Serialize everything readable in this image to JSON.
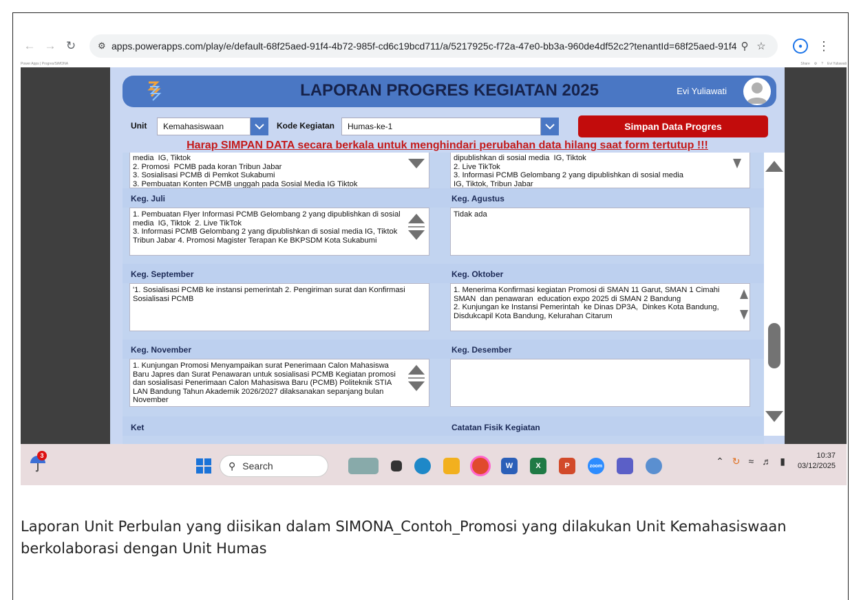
{
  "browser": {
    "url": "apps.powerapps.com/play/e/default-68f25aed-91f4-4b72-985f-cd6c19bcd711/a/5217925c-f72a-47e0-bb3a-960de4df52c2?tenantId=68f25aed-91f4-4b72...",
    "bookmark_left": "Power Apps | Progres/SiMONA",
    "bookmarks_right": [
      "Share",
      "⚙",
      "?",
      "Evi Yuliawati"
    ]
  },
  "app": {
    "title": "LAPORAN PROGRES KEGIATAN 2025",
    "user_name": "Evi Yuliawati",
    "unit_label": "Unit",
    "unit_value": "Kemahasiswaan",
    "kode_label": "Kode Kegiatan",
    "kode_value": "Humas-ke-1",
    "save_label": "Simpan Data Progres",
    "warning": "Harap SIMPAN DATA secara berkala untuk menghindari perubahan data hilang saat form tertutup !!!",
    "top_left_text": "media  IG, Tiktok\n2. Promosi  PCMB pada koran Tribun Jabar\n3. Sosialisasi PCMB di Pemkot Sukabumi\n3. Pembuatan Konten PCMB unggah pada Sosial Media IG Tiktok",
    "top_right_text": "dipublishkan di sosial media  IG, Tiktok\n2. Live TikTok\n3. Informasi PCMB Gelombang 2 yang dipublishkan di sosial media\nIG, Tiktok, Tribun Jabar",
    "sections": {
      "juli_label": "Keg. Juli",
      "juli_text": "1. Pembuatan Flyer Informasi PCMB Gelombang 2 yang dipublishkan di sosial media  IG, Tiktok  2. Live TikTok\n3. Informasi PCMB Gelombang 2 yang dipublishkan di sosial media IG, Tiktok  Tribun Jabar 4. Promosi Magister Terapan Ke BKPSDM Kota Sukabumi",
      "agustus_label": "Keg. Agustus",
      "agustus_text": "Tidak ada",
      "september_label": "Keg. September",
      "september_text": "'1. Sosialisasi PCMB ke instansi pemerintah 2. Pengiriman surat dan Konfirmasi Sosialisasi PCMB",
      "oktober_label": "Keg. Oktober",
      "oktober_text": "1. Menerima Konfirmasi kegiatan Promosi di SMAN 11 Garut, SMAN 1 Cimahi SMAN  dan penawaran  education expo 2025 di SMAN 2 Bandung\n2. Kunjungan ke Instansi Pemerintah  ke Dinas DP3A,  Dinkes Kota Bandung, Disdukcapil Kota Bandung, Kelurahan Citarum",
      "november_label": "Keg. November",
      "november_text": "1. Kunjungan Promosi Menyampaikan surat Penerimaan Calon Mahasiswa Baru Japres dan Surat Penawaran untuk sosialisasi PCMB Kegiatan promosi dan sosialisasi Penerimaan Calon Mahasiswa Baru (PCMB) Politeknik STIA LAN Bandung Tahun Akademik 2026/2027 dilaksanakan sepanjang bulan November",
      "desember_label": "Keg. Desember",
      "desember_text": "",
      "bottom_left_label": "Ket",
      "bottom_right_label": "Catatan Fisik Kegiatan"
    }
  },
  "taskbar": {
    "weather_badge": "3",
    "search_placeholder": "Search",
    "time": "10:37",
    "date": "03/12/2025"
  },
  "caption": "Laporan Unit Perbulan yang diisikan dalam SIMONA_Contoh_Promosi yang dilakukan Unit Kemahasiswaan berkolaborasi dengan Unit Humas",
  "colors": {
    "header_bg": "#4a77c4",
    "save_button": "#c20c0c",
    "warning_text": "#c41a1a",
    "canvas_bg": "#c9d7f2"
  }
}
